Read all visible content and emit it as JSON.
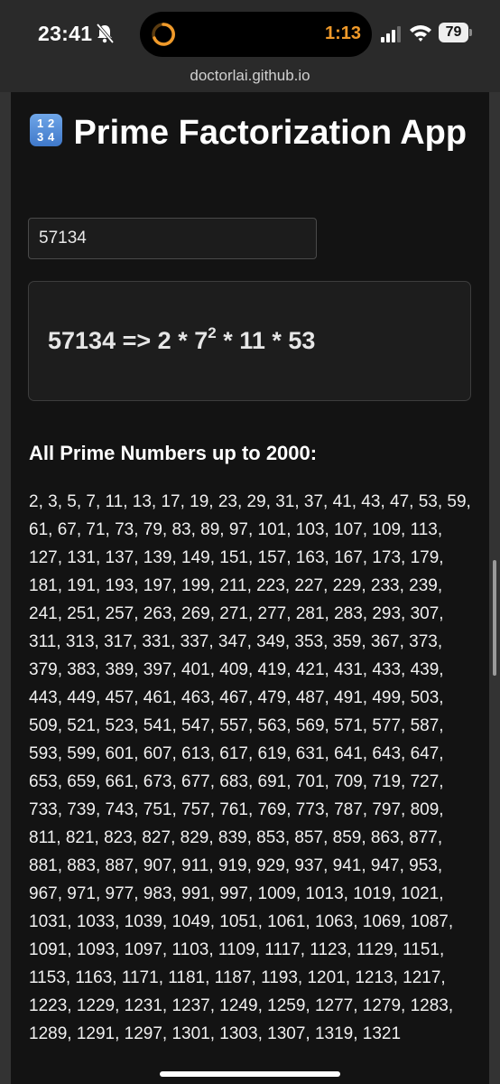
{
  "status_bar": {
    "time": "23:41",
    "timer": "1:13",
    "battery": "79",
    "url": "doctorlai.github.io",
    "icons": [
      "bell-slash-icon",
      "timer-ring-icon",
      "signal-icon",
      "wifi-icon",
      "battery-icon"
    ],
    "colors": {
      "timer": "#f09a2a",
      "bar": "#2a2a2a"
    }
  },
  "app": {
    "icon": "input-numbers-icon",
    "icon_glyphs": [
      "1",
      "2",
      "3",
      "4"
    ],
    "title": "Prime Factorization App",
    "input_value": "57134",
    "result": {
      "number": "57134",
      "arrow": "=>",
      "terms": [
        "2",
        "7",
        "11",
        "53"
      ],
      "exponent": "2",
      "separator": "*"
    },
    "primes_heading": "All Prime Numbers up to 2000:",
    "primes": "2, 3, 5, 7, 11, 13, 17, 19, 23, 29, 31, 37, 41, 43, 47, 53, 59, 61, 67, 71, 73, 79, 83, 89, 97, 101, 103, 107, 109, 113, 127, 131, 137, 139, 149, 151, 157, 163, 167, 173, 179, 181, 191, 193, 197, 199, 211, 223, 227, 229, 233, 239, 241, 251, 257, 263, 269, 271, 277, 281, 283, 293, 307, 311, 313, 317, 331, 337, 347, 349, 353, 359, 367, 373, 379, 383, 389, 397, 401, 409, 419, 421, 431, 433, 439, 443, 449, 457, 461, 463, 467, 479, 487, 491, 499, 503, 509, 521, 523, 541, 547, 557, 563, 569, 571, 577, 587, 593, 599, 601, 607, 613, 617, 619, 631, 641, 643, 647, 653, 659, 661, 673, 677, 683, 691, 701, 709, 719, 727, 733, 739, 743, 751, 757, 761, 769, 773, 787, 797, 809, 811, 821, 823, 827, 829, 839, 853, 857, 859, 863, 877, 881, 883, 887, 907, 911, 919, 929, 937, 941, 947, 953, 967, 971, 977, 983, 991, 997, 1009, 1013, 1019, 1021, 1031, 1033, 1039, 1049, 1051, 1061, 1063, 1069, 1087, 1091, 1093, 1097, 1103, 1109, 1117, 1123, 1129, 1151, 1153, 1163, 1171, 1181, 1187, 1193, 1201, 1213, 1217, 1223, 1229, 1231, 1237, 1249, 1259, 1277, 1279, 1283, 1289, 1291, 1297, 1301, 1303, 1307, 1319, 1321"
  }
}
